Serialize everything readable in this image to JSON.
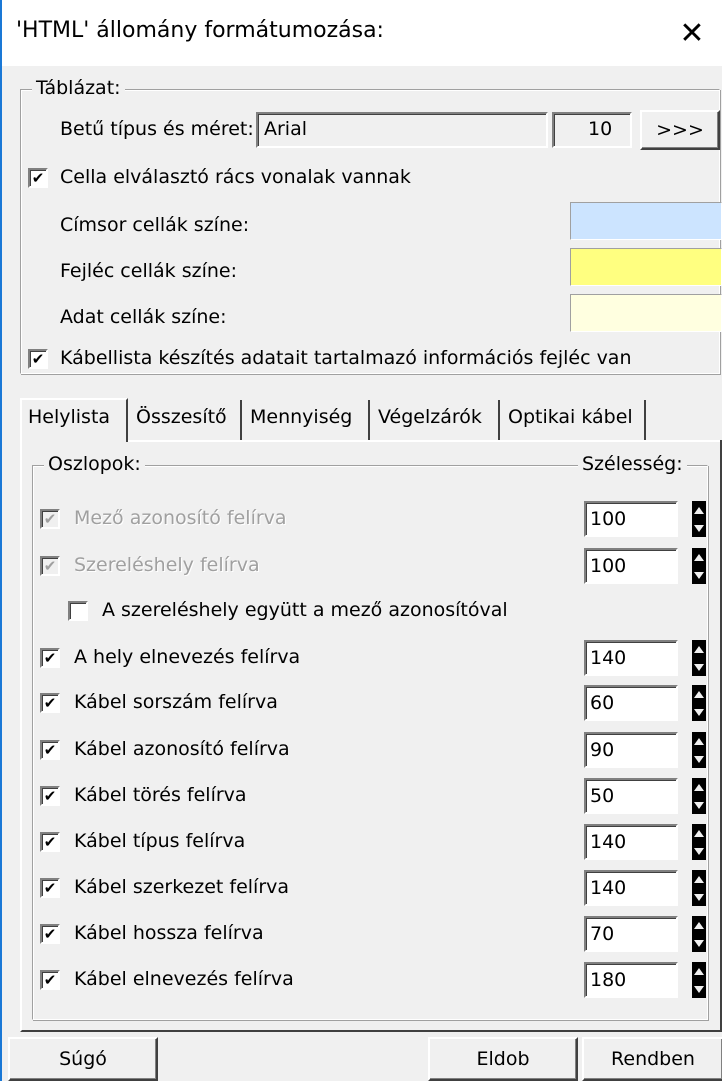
{
  "window": {
    "title": "'HTML' állomány formátumozása:"
  },
  "table_group": {
    "title": "Táblázat:",
    "font_label": "Betű típus és méret:",
    "font_name": "Arial",
    "font_size": "10",
    "font_button": ">>>",
    "grid_lines": {
      "label": "Cella elválasztó rács vonalak vannak",
      "checked": true
    },
    "title_cells": {
      "label": "Címsor cellák színe:",
      "color": "#cce4ff"
    },
    "header_cells": {
      "label": "Fejléc cellák színe:",
      "color": "#ffff80"
    },
    "data_cells": {
      "label": "Adat cellák színe:",
      "color": "#ffffe0"
    },
    "info_header": {
      "label": "Kábellista készítés adatait tartalmazó információs fejléc van",
      "checked": true
    }
  },
  "tabs": [
    {
      "label": "Helylista",
      "active": true
    },
    {
      "label": "Összesítő",
      "active": false
    },
    {
      "label": "Mennyiség",
      "active": false
    },
    {
      "label": "Végelzárók",
      "active": false
    },
    {
      "label": "Optikai kábel",
      "active": false
    }
  ],
  "columns_group": {
    "title": "Oszlopok:",
    "width_title": "Szélesség:",
    "rows": [
      {
        "label": "Mező azonosító felírva",
        "checked": true,
        "enabled": false,
        "width": "100"
      },
      {
        "label": "Szereléshely felírva",
        "checked": true,
        "enabled": false,
        "width": "100"
      },
      {
        "label": "A szereléshely együtt a mező azonosítóval",
        "checked": false,
        "enabled": true
      },
      {
        "label": "A hely elnevezés felírva",
        "checked": true,
        "enabled": true,
        "width": "140"
      },
      {
        "label": "Kábel sorszám felírva",
        "checked": true,
        "enabled": true,
        "width": "60"
      },
      {
        "label": "Kábel azonosító felírva",
        "checked": true,
        "enabled": true,
        "width": "90"
      },
      {
        "label": "Kábel törés felírva",
        "checked": true,
        "enabled": true,
        "width": "50"
      },
      {
        "label": "Kábel típus felírva",
        "checked": true,
        "enabled": true,
        "width": "140"
      },
      {
        "label": "Kábel szerkezet felírva",
        "checked": true,
        "enabled": true,
        "width": "140"
      },
      {
        "label": "Kábel hossza felírva",
        "checked": true,
        "enabled": true,
        "width": "70"
      },
      {
        "label": "Kábel elnevezés felírva",
        "checked": true,
        "enabled": true,
        "width": "180"
      }
    ]
  },
  "footer": {
    "help": "Súgó",
    "discard": "Eldob",
    "ok": "Rendben"
  }
}
